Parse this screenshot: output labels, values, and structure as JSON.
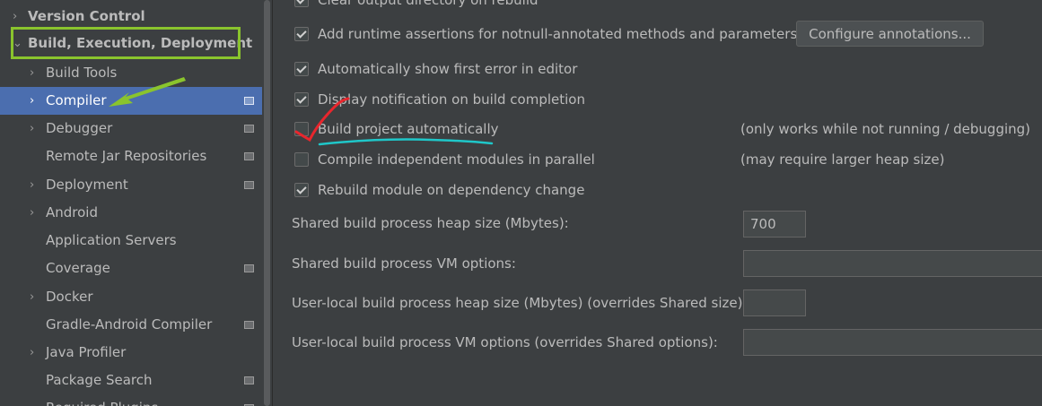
{
  "sidebar": {
    "items": [
      {
        "label": "Version Control",
        "chevron": "›"
      },
      {
        "label": "Build, Execution, Deployment",
        "chevron": "⌄"
      },
      {
        "label": "Build Tools",
        "chevron": "›"
      },
      {
        "label": "Compiler",
        "chevron": "›"
      },
      {
        "label": "Debugger",
        "chevron": "›"
      },
      {
        "label": "Remote Jar Repositories",
        "chevron": ""
      },
      {
        "label": "Deployment",
        "chevron": "›"
      },
      {
        "label": "Android",
        "chevron": "›"
      },
      {
        "label": "Application Servers",
        "chevron": ""
      },
      {
        "label": "Coverage",
        "chevron": ""
      },
      {
        "label": "Docker",
        "chevron": "›"
      },
      {
        "label": "Gradle-Android Compiler",
        "chevron": ""
      },
      {
        "label": "Java Profiler",
        "chevron": "›"
      },
      {
        "label": "Package Search",
        "chevron": ""
      },
      {
        "label": "Required Plugins",
        "chevron": ""
      }
    ]
  },
  "options": [
    {
      "label": "Clear output directory on rebuild",
      "checked": true
    },
    {
      "label": "Add runtime assertions for notnull-annotated methods and parameters",
      "checked": true
    },
    {
      "label": "Automatically show first error in editor",
      "checked": true
    },
    {
      "label": "Display notification on build completion",
      "checked": true
    },
    {
      "label": "Build project automatically",
      "checked": false
    },
    {
      "label": "Compile independent modules in parallel",
      "checked": false
    },
    {
      "label": "Rebuild module on dependency change",
      "checked": true
    }
  ],
  "configure_button": "Configure annotations...",
  "notes": {
    "build_auto": "(only works while not running / debugging)",
    "parallel": "(may require larger heap size)"
  },
  "fields": {
    "shared_heap": {
      "label": "Shared build process heap size (Mbytes):",
      "value": "700"
    },
    "shared_vm": {
      "label": "Shared build process VM options:",
      "value": ""
    },
    "user_heap": {
      "label": "User-local build process heap size (Mbytes) (overrides Shared size):",
      "value": ""
    },
    "user_vm": {
      "label": "User-local build process VM options (overrides Shared options):",
      "value": ""
    }
  },
  "colors": {
    "background": "#3c3f41",
    "selection": "#4b6eaf",
    "highlight_box": "#8ac42d",
    "arrow": "#8ac42d",
    "checkmark_annotation": "#e8262d",
    "underline_annotation": "#1fc7c9"
  }
}
